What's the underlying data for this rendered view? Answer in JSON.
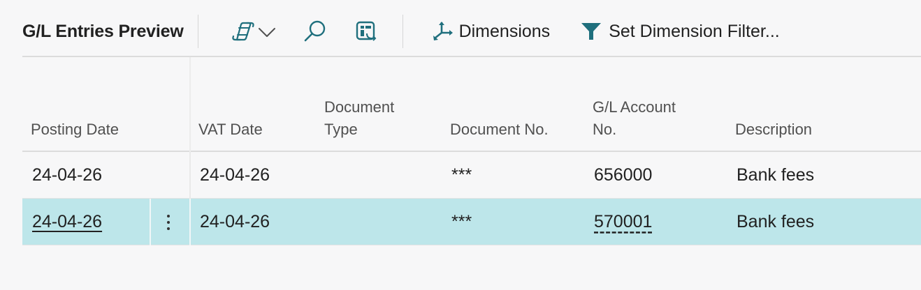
{
  "toolbar": {
    "title": "G/L Entries Preview",
    "copilot_icon": "copilot-icon",
    "search_icon": "search-icon",
    "layout_icon": "personalize-icon",
    "dimensions_label": "Dimensions",
    "filter_label": "Set Dimension Filter..."
  },
  "columns": {
    "posting_date": "Posting Date",
    "vat_date": "VAT Date",
    "document_type_1": "Document",
    "document_type_2": "Type",
    "document_no": "Document No.",
    "gl_account_1": "G/L Account",
    "gl_account_2": "No.",
    "description": "Description"
  },
  "rows": [
    {
      "posting_date": "24-04-26",
      "vat_date": "24-04-26",
      "document_type": "",
      "document_no": "***",
      "gl_account_no": "656000",
      "description": "Bank fees"
    },
    {
      "posting_date": "24-04-26",
      "vat_date": "24-04-26",
      "document_type": "",
      "document_no": "***",
      "gl_account_no": "570001",
      "description": "Bank fees"
    }
  ],
  "colors": {
    "selected_row": "#bde6ea",
    "accent_icon": "#1f6f7d"
  }
}
